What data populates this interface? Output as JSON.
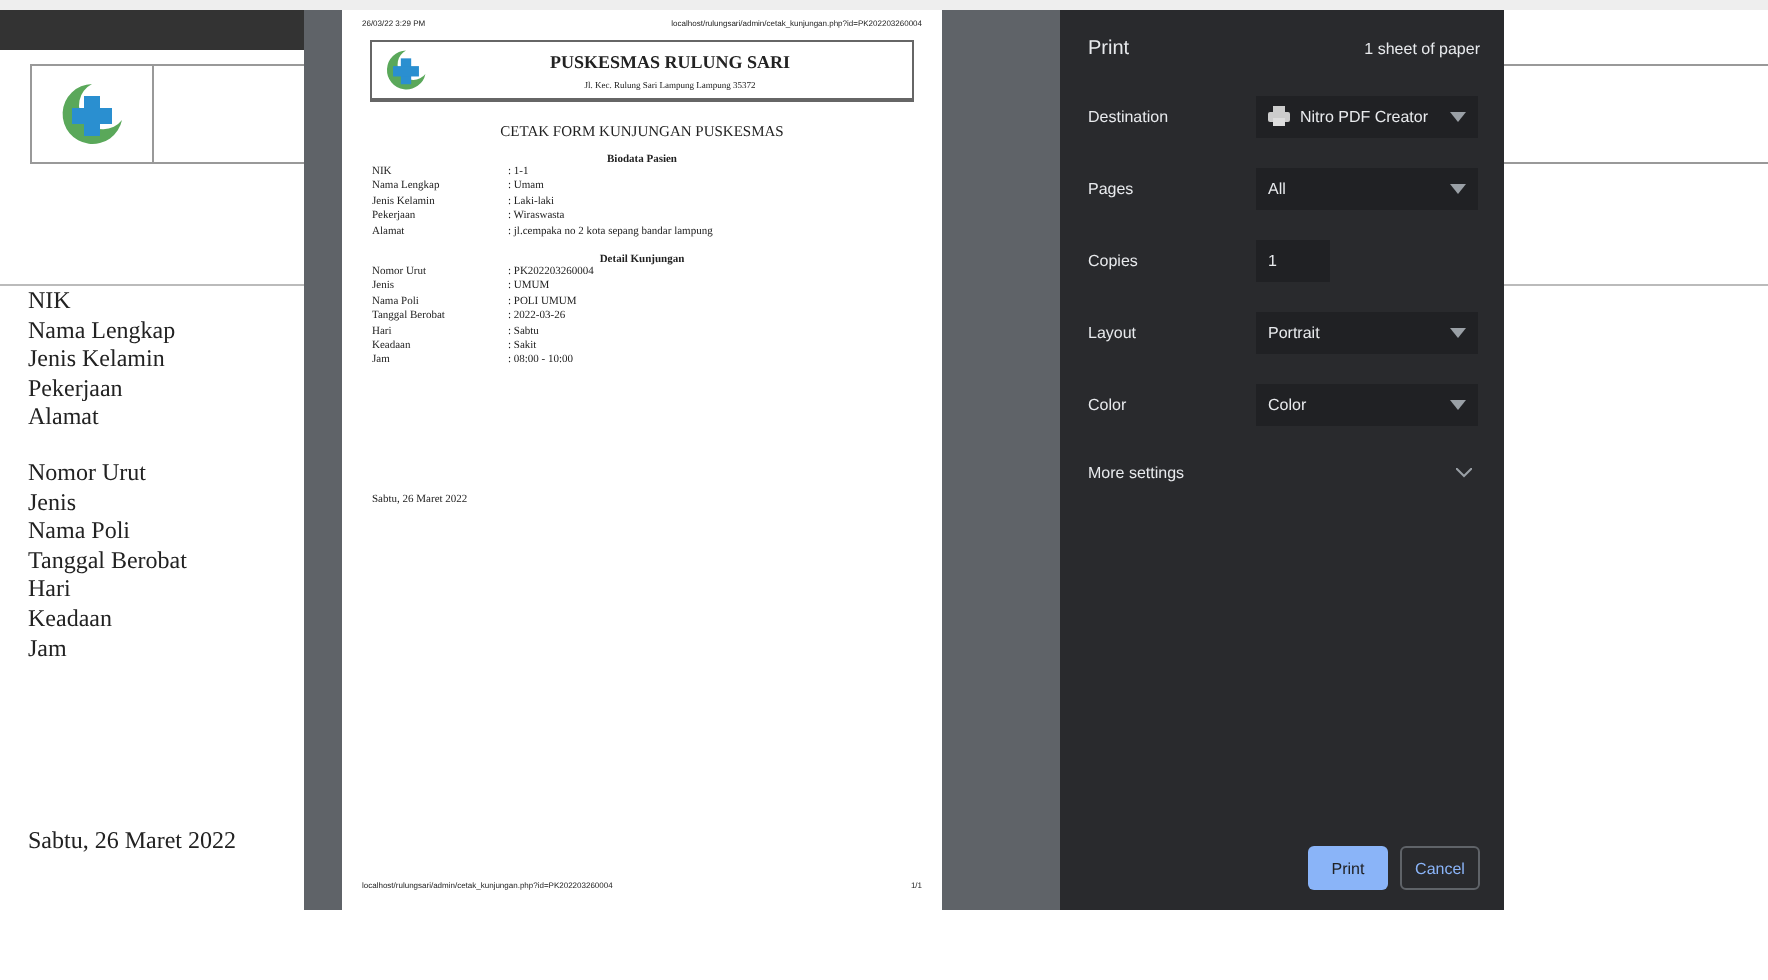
{
  "background_page": {
    "labels": [
      "NIK",
      "Nama Lengkap",
      "Jenis Kelamin",
      "Pekerjaan",
      "Alamat"
    ],
    "labels_2": [
      "Nomor Urut",
      "Jenis",
      "Nama Poli",
      "Tanggal Berobat",
      "Hari",
      "Keadaan",
      "Jam"
    ],
    "signature_date": "Sabtu, 26 Maret 2022"
  },
  "preview": {
    "header_left": "26/03/22 3:29 PM",
    "header_right": "localhost/rulungsari/admin/cetak_kunjungan.php?id=PK202203260004",
    "clinic_name": "PUSKESMAS RULUNG SARI",
    "clinic_address": "Jl. Kec. Rulung Sari Lampung Lampung 35372",
    "title": "CETAK FORM KUNJUNGAN PUSKESMAS",
    "sections": [
      {
        "heading": "Biodata Pasien",
        "rows": [
          {
            "label": "NIK",
            "value": ": 1-1"
          },
          {
            "label": "Nama Lengkap",
            "value": ": Umam"
          },
          {
            "label": "Jenis Kelamin",
            "value": ": Laki-laki"
          },
          {
            "label": "Pekerjaan",
            "value": ": Wiraswasta"
          },
          {
            "label": "Alamat",
            "value": ": jl.cempaka no 2 kota sepang bandar lampung"
          }
        ]
      },
      {
        "heading": "Detail Kunjungan",
        "rows": [
          {
            "label": "Nomor Urut",
            "value": ": PK202203260004"
          },
          {
            "label": "Jenis",
            "value": ": UMUM"
          },
          {
            "label": "Nama Poli",
            "value": ": POLI UMUM"
          },
          {
            "label": "Tanggal Berobat",
            "value": ": 2022-03-26"
          },
          {
            "label": "Hari",
            "value": ": Sabtu"
          },
          {
            "label": "Keadaan",
            "value": ": Sakit"
          },
          {
            "label": "Jam",
            "value": ": 08:00 - 10:00"
          }
        ]
      }
    ],
    "signature_date": "Sabtu, 26 Maret 2022",
    "footer_url": "localhost/rulungsari/admin/cetak_kunjungan.php?id=PK202203260004",
    "page_number": "1/1"
  },
  "print_panel": {
    "title": "Print",
    "sheets": "1 sheet of paper",
    "settings": [
      {
        "kind": "select",
        "label": "Destination",
        "value": "Nitro PDF Creator",
        "printer_icon": true
      },
      {
        "kind": "select",
        "label": "Pages",
        "value": "All",
        "printer_icon": false
      },
      {
        "kind": "number",
        "label": "Copies",
        "value": "1"
      },
      {
        "kind": "select",
        "label": "Layout",
        "value": "Portrait",
        "printer_icon": false
      },
      {
        "kind": "select",
        "label": "Color",
        "value": "Color",
        "printer_icon": false
      }
    ],
    "more_settings": {
      "label": "More settings",
      "expanded": false
    },
    "buttons": [
      {
        "label": "Print",
        "kind": "primary"
      },
      {
        "label": "Cancel",
        "kind": "secondary"
      }
    ]
  }
}
